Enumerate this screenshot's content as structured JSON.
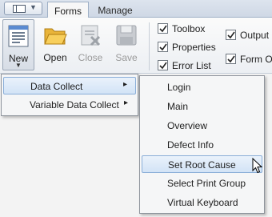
{
  "tabs": {
    "forms": "Forms",
    "manage": "Manage"
  },
  "ribbon": {
    "new_label": "New",
    "open_label": "Open",
    "close_label": "Close",
    "save_label": "Save",
    "checkboxes": [
      {
        "label": "Toolbox",
        "checked": true
      },
      {
        "label": "Properties",
        "checked": true
      },
      {
        "label": "Error List",
        "checked": true
      },
      {
        "label": "Output",
        "checked": true
      },
      {
        "label": "Form Ou",
        "checked": true
      }
    ]
  },
  "new_menu": {
    "items": [
      {
        "label": "Data Collect",
        "arrow": "▸",
        "active": true
      },
      {
        "label": "Variable Data Collect",
        "arrow": "▸",
        "active": false
      }
    ]
  },
  "data_collect_submenu": {
    "items": [
      {
        "label": "Login"
      },
      {
        "label": "Main"
      },
      {
        "label": "Overview"
      },
      {
        "label": "Defect Info"
      },
      {
        "label": "Set Root Cause",
        "hovered": true
      },
      {
        "label": "Select Print Group"
      },
      {
        "label": "Virtual Keyboard"
      }
    ]
  },
  "colors": {
    "highlight_border": "#8aaed8",
    "highlight_fill": "#d2e3f6",
    "ribbon_bg": "#f3f3f3"
  }
}
